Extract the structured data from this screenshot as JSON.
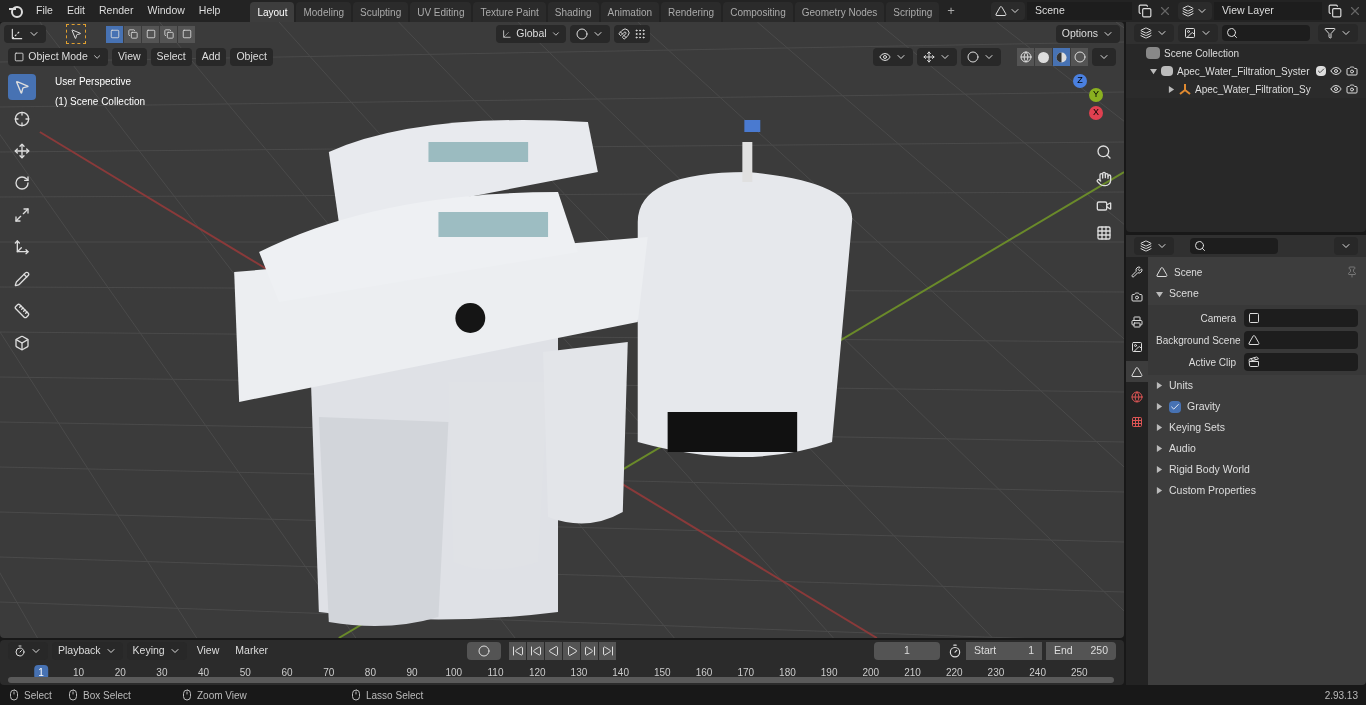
{
  "menu": [
    "File",
    "Edit",
    "Render",
    "Window",
    "Help"
  ],
  "workspaces": [
    {
      "label": "Layout",
      "selected": true
    },
    {
      "label": "Modeling",
      "selected": false
    },
    {
      "label": "Sculpting",
      "selected": false
    },
    {
      "label": "UV Editing",
      "selected": false
    },
    {
      "label": "Texture Paint",
      "selected": false
    },
    {
      "label": "Shading",
      "selected": false
    },
    {
      "label": "Animation",
      "selected": false
    },
    {
      "label": "Rendering",
      "selected": false
    },
    {
      "label": "Compositing",
      "selected": false
    },
    {
      "label": "Geometry Nodes",
      "selected": false
    },
    {
      "label": "Scripting",
      "selected": false
    }
  ],
  "add_workspace": "+",
  "scene_field": {
    "value": "Scene"
  },
  "view_layer_field": {
    "value": "View Layer"
  },
  "viewport": {
    "mode": "Object Mode",
    "menus": [
      "View",
      "Select",
      "Add",
      "Object"
    ],
    "orientation": "Global",
    "options": "Options",
    "select_modes": [
      {
        "kind": "new",
        "selected": true
      },
      {
        "kind": "extend",
        "selected": false
      },
      {
        "kind": "subtract",
        "selected": false
      },
      {
        "kind": "invert",
        "selected": false
      },
      {
        "kind": "intersect",
        "selected": false
      }
    ],
    "shading": [
      {
        "kind": "wireframe",
        "selected": false
      },
      {
        "kind": "solid",
        "selected": false
      },
      {
        "kind": "material",
        "selected": true
      },
      {
        "kind": "rendered",
        "selected": false
      }
    ],
    "overlay": [
      "User Perspective",
      "(1) Scene Collection"
    ],
    "tools": [
      {
        "kind": "select",
        "selected": true
      },
      {
        "kind": "cursor",
        "selected": false
      },
      {
        "kind": "move",
        "selected": false
      },
      {
        "kind": "rotate",
        "selected": false
      },
      {
        "kind": "scale",
        "selected": false
      },
      {
        "kind": "transform",
        "selected": false
      },
      {
        "kind": "annotate",
        "selected": false
      },
      {
        "kind": "measure",
        "selected": false
      },
      {
        "kind": "add-cube",
        "selected": false
      }
    ],
    "gizmo_axes": [
      "Z",
      "Y",
      "X"
    ]
  },
  "outliner": {
    "root": "Scene Collection",
    "items": [
      {
        "label": "Apec_Water_Filtration_Syster",
        "kind": "collection",
        "checked": true,
        "expanded": true,
        "children": [
          {
            "label": "Apec_Water_Filtration_Sy",
            "kind": "object",
            "expanded": false
          }
        ]
      }
    ]
  },
  "properties": {
    "title": "Scene",
    "tabs": [
      {
        "kind": "tool",
        "selected": false
      },
      {
        "kind": "render",
        "selected": false
      },
      {
        "kind": "output",
        "selected": false
      },
      {
        "kind": "view-layer",
        "selected": false
      },
      {
        "kind": "scene",
        "selected": true
      },
      {
        "kind": "world",
        "selected": false
      },
      {
        "kind": "texture",
        "selected": false
      }
    ],
    "panel": {
      "title": "Scene",
      "expanded": true,
      "fields": [
        {
          "label": "Camera",
          "kind": "camera"
        },
        {
          "label": "Background Scene",
          "kind": "scene"
        },
        {
          "label": "Active Clip",
          "kind": "clip"
        }
      ]
    },
    "sections": [
      {
        "label": "Units",
        "kind": "plain"
      },
      {
        "label": "Gravity",
        "kind": "checkbox",
        "checked": true
      },
      {
        "label": "Keying Sets",
        "kind": "plain"
      },
      {
        "label": "Audio",
        "kind": "plain"
      },
      {
        "label": "Rigid Body World",
        "kind": "plain"
      },
      {
        "label": "Custom Properties",
        "kind": "plain"
      }
    ]
  },
  "timeline": {
    "menus": [
      "Playback",
      "Keying"
    ],
    "links": [
      "View",
      "Marker"
    ],
    "current_frame": "1",
    "start": {
      "label": "Start",
      "value": "1"
    },
    "end": {
      "label": "End",
      "value": "250"
    },
    "ruler": [
      "1",
      "10",
      "20",
      "30",
      "40",
      "50",
      "60",
      "70",
      "80",
      "90",
      "100",
      "110",
      "120",
      "130",
      "140",
      "150",
      "160",
      "170",
      "180",
      "190",
      "200",
      "210",
      "220",
      "230",
      "240",
      "250"
    ]
  },
  "status_bar": {
    "hints": [
      "Select",
      "Box Select",
      "Zoom View",
      "Lasso Select"
    ],
    "version": "2.93.13"
  }
}
